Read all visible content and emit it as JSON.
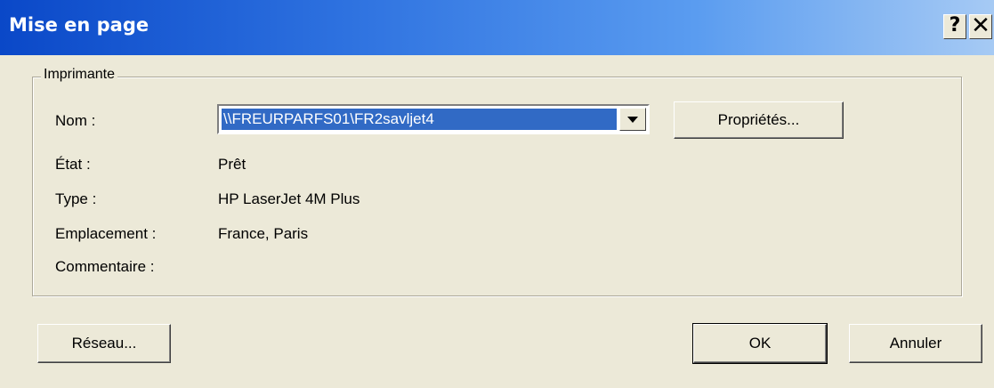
{
  "window": {
    "title": "Mise en page",
    "help_glyph": "?",
    "close_glyph": "✕"
  },
  "printer_group": {
    "label": "Imprimante",
    "name_label": "Nom :",
    "name_value": "\\\\FREURPARFS01\\FR2savljet4",
    "properties_button": "Propriétés...",
    "state_label": "État :",
    "state_value": "Prêt",
    "type_label": "Type :",
    "type_value": "HP LaserJet 4M Plus",
    "location_label": "Emplacement :",
    "location_value": "France, Paris",
    "comment_label": "Commentaire :",
    "comment_value": ""
  },
  "buttons": {
    "network": "Réseau...",
    "ok": "OK",
    "cancel": "Annuler"
  },
  "icons": {
    "help": "question-mark-icon",
    "close": "close-icon",
    "dropdown": "chevron-down-icon"
  }
}
